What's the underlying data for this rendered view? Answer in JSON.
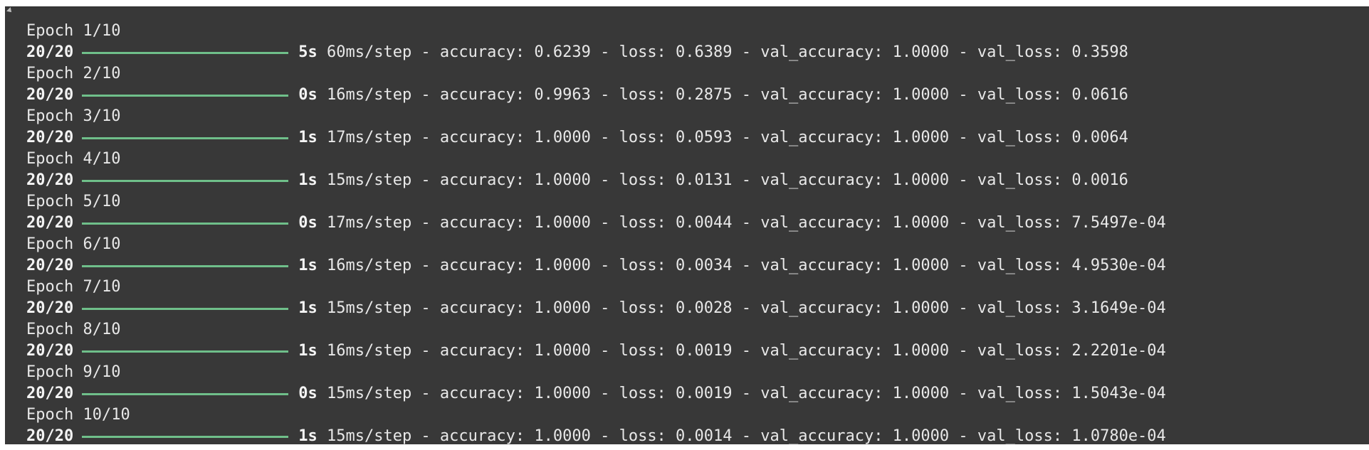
{
  "epochs": [
    {
      "epoch": "Epoch 1/10",
      "steps": "20/20",
      "time": "5s",
      "rest": " 60ms/step - accuracy: 0.6239 - loss: 0.6389 - val_accuracy: 1.0000 - val_loss: 0.3598"
    },
    {
      "epoch": "Epoch 2/10",
      "steps": "20/20",
      "time": "0s",
      "rest": " 16ms/step - accuracy: 0.9963 - loss: 0.2875 - val_accuracy: 1.0000 - val_loss: 0.0616"
    },
    {
      "epoch": "Epoch 3/10",
      "steps": "20/20",
      "time": "1s",
      "rest": " 17ms/step - accuracy: 1.0000 - loss: 0.0593 - val_accuracy: 1.0000 - val_loss: 0.0064"
    },
    {
      "epoch": "Epoch 4/10",
      "steps": "20/20",
      "time": "1s",
      "rest": " 15ms/step - accuracy: 1.0000 - loss: 0.0131 - val_accuracy: 1.0000 - val_loss: 0.0016"
    },
    {
      "epoch": "Epoch 5/10",
      "steps": "20/20",
      "time": "0s",
      "rest": " 17ms/step - accuracy: 1.0000 - loss: 0.0044 - val_accuracy: 1.0000 - val_loss: 7.5497e-04"
    },
    {
      "epoch": "Epoch 6/10",
      "steps": "20/20",
      "time": "1s",
      "rest": " 16ms/step - accuracy: 1.0000 - loss: 0.0034 - val_accuracy: 1.0000 - val_loss: 4.9530e-04"
    },
    {
      "epoch": "Epoch 7/10",
      "steps": "20/20",
      "time": "1s",
      "rest": " 15ms/step - accuracy: 1.0000 - loss: 0.0028 - val_accuracy: 1.0000 - val_loss: 3.1649e-04"
    },
    {
      "epoch": "Epoch 8/10",
      "steps": "20/20",
      "time": "1s",
      "rest": " 16ms/step - accuracy: 1.0000 - loss: 0.0019 - val_accuracy: 1.0000 - val_loss: 2.2201e-04"
    },
    {
      "epoch": "Epoch 9/10",
      "steps": "20/20",
      "time": "0s",
      "rest": " 15ms/step - accuracy: 1.0000 - loss: 0.0019 - val_accuracy: 1.0000 - val_loss: 1.5043e-04"
    },
    {
      "epoch": "Epoch 10/10",
      "steps": "20/20",
      "time": "1s",
      "rest": " 15ms/step - accuracy: 1.0000 - loss: 0.0014 - val_accuracy: 1.0000 - val_loss: 1.0780e-04"
    }
  ],
  "progress_fraction": 1.0,
  "colors": {
    "background": "#383838",
    "text": "#e8e8e8",
    "progress_bar": "#6fbf8a"
  }
}
